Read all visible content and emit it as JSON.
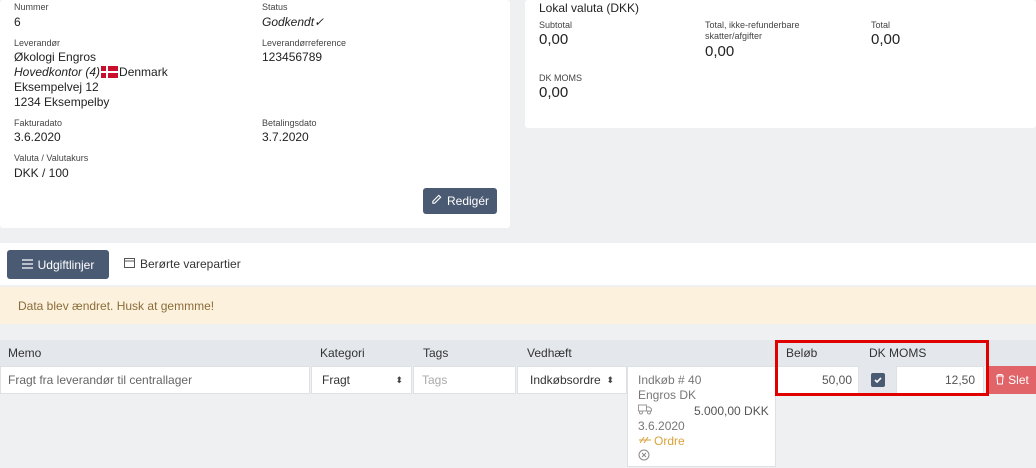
{
  "invoice": {
    "number_label": "Nummer",
    "number": "6",
    "status_label": "Status",
    "status": "Godkendt",
    "supplier_label": "Leverandør",
    "supplier_name": "Økologi Engros",
    "supplier_office": "Hovedkontor (4)",
    "supplier_country": "Denmark",
    "supplier_street": "Eksempelvej 12",
    "supplier_city": "1234 Eksempelby",
    "supplier_ref_label": "Leverandørreference",
    "supplier_ref": "123456789",
    "invoice_date_label": "Fakturadato",
    "invoice_date": "3.6.2020",
    "payment_date_label": "Betalingsdato",
    "payment_date": "3.7.2020",
    "currency_label": "Valuta / Valutakurs",
    "currency": "DKK / 100",
    "edit_label": "Redigér"
  },
  "local": {
    "title": "Lokal valuta (DKK)",
    "subtotal_label": "Subtotal",
    "subtotal": "0,00",
    "nonrefund_label_1": "Total, ikke-refunderbare",
    "nonrefund_label_2": "skatter/afgifter",
    "nonrefund": "0,00",
    "total_label": "Total",
    "total": "0,00",
    "vat_label": "DK MOMS",
    "vat": "0,00"
  },
  "tabs": {
    "expense_lines": "Udgiftlinjer",
    "batches": "Berørte varepartier"
  },
  "alert": "Data blev ændret. Husk at gemmme!",
  "table": {
    "headers": {
      "memo": "Memo",
      "category": "Kategori",
      "tags": "Tags",
      "attached": "Vedhæft",
      "amount": "Beløb",
      "vat": "DK MOMS"
    },
    "row": {
      "memo": "Fragt fra leverandør til centrallager",
      "category": "Fragt",
      "tags_placeholder": "Tags",
      "attached": "Indkøbsordre",
      "amount": "50,00",
      "vat": "12,50",
      "delete": "Slet"
    },
    "popover": {
      "title": "Indkøb # 40",
      "supplier": "Engros DK",
      "amount": "5.000,00 DKK",
      "date": "3.6.2020",
      "link": "Ordre"
    }
  },
  "colors": {
    "accent": "#4a5a73",
    "highlight": "#e00000",
    "delete": "#e06468",
    "alert_bg": "#fcf1dc"
  }
}
